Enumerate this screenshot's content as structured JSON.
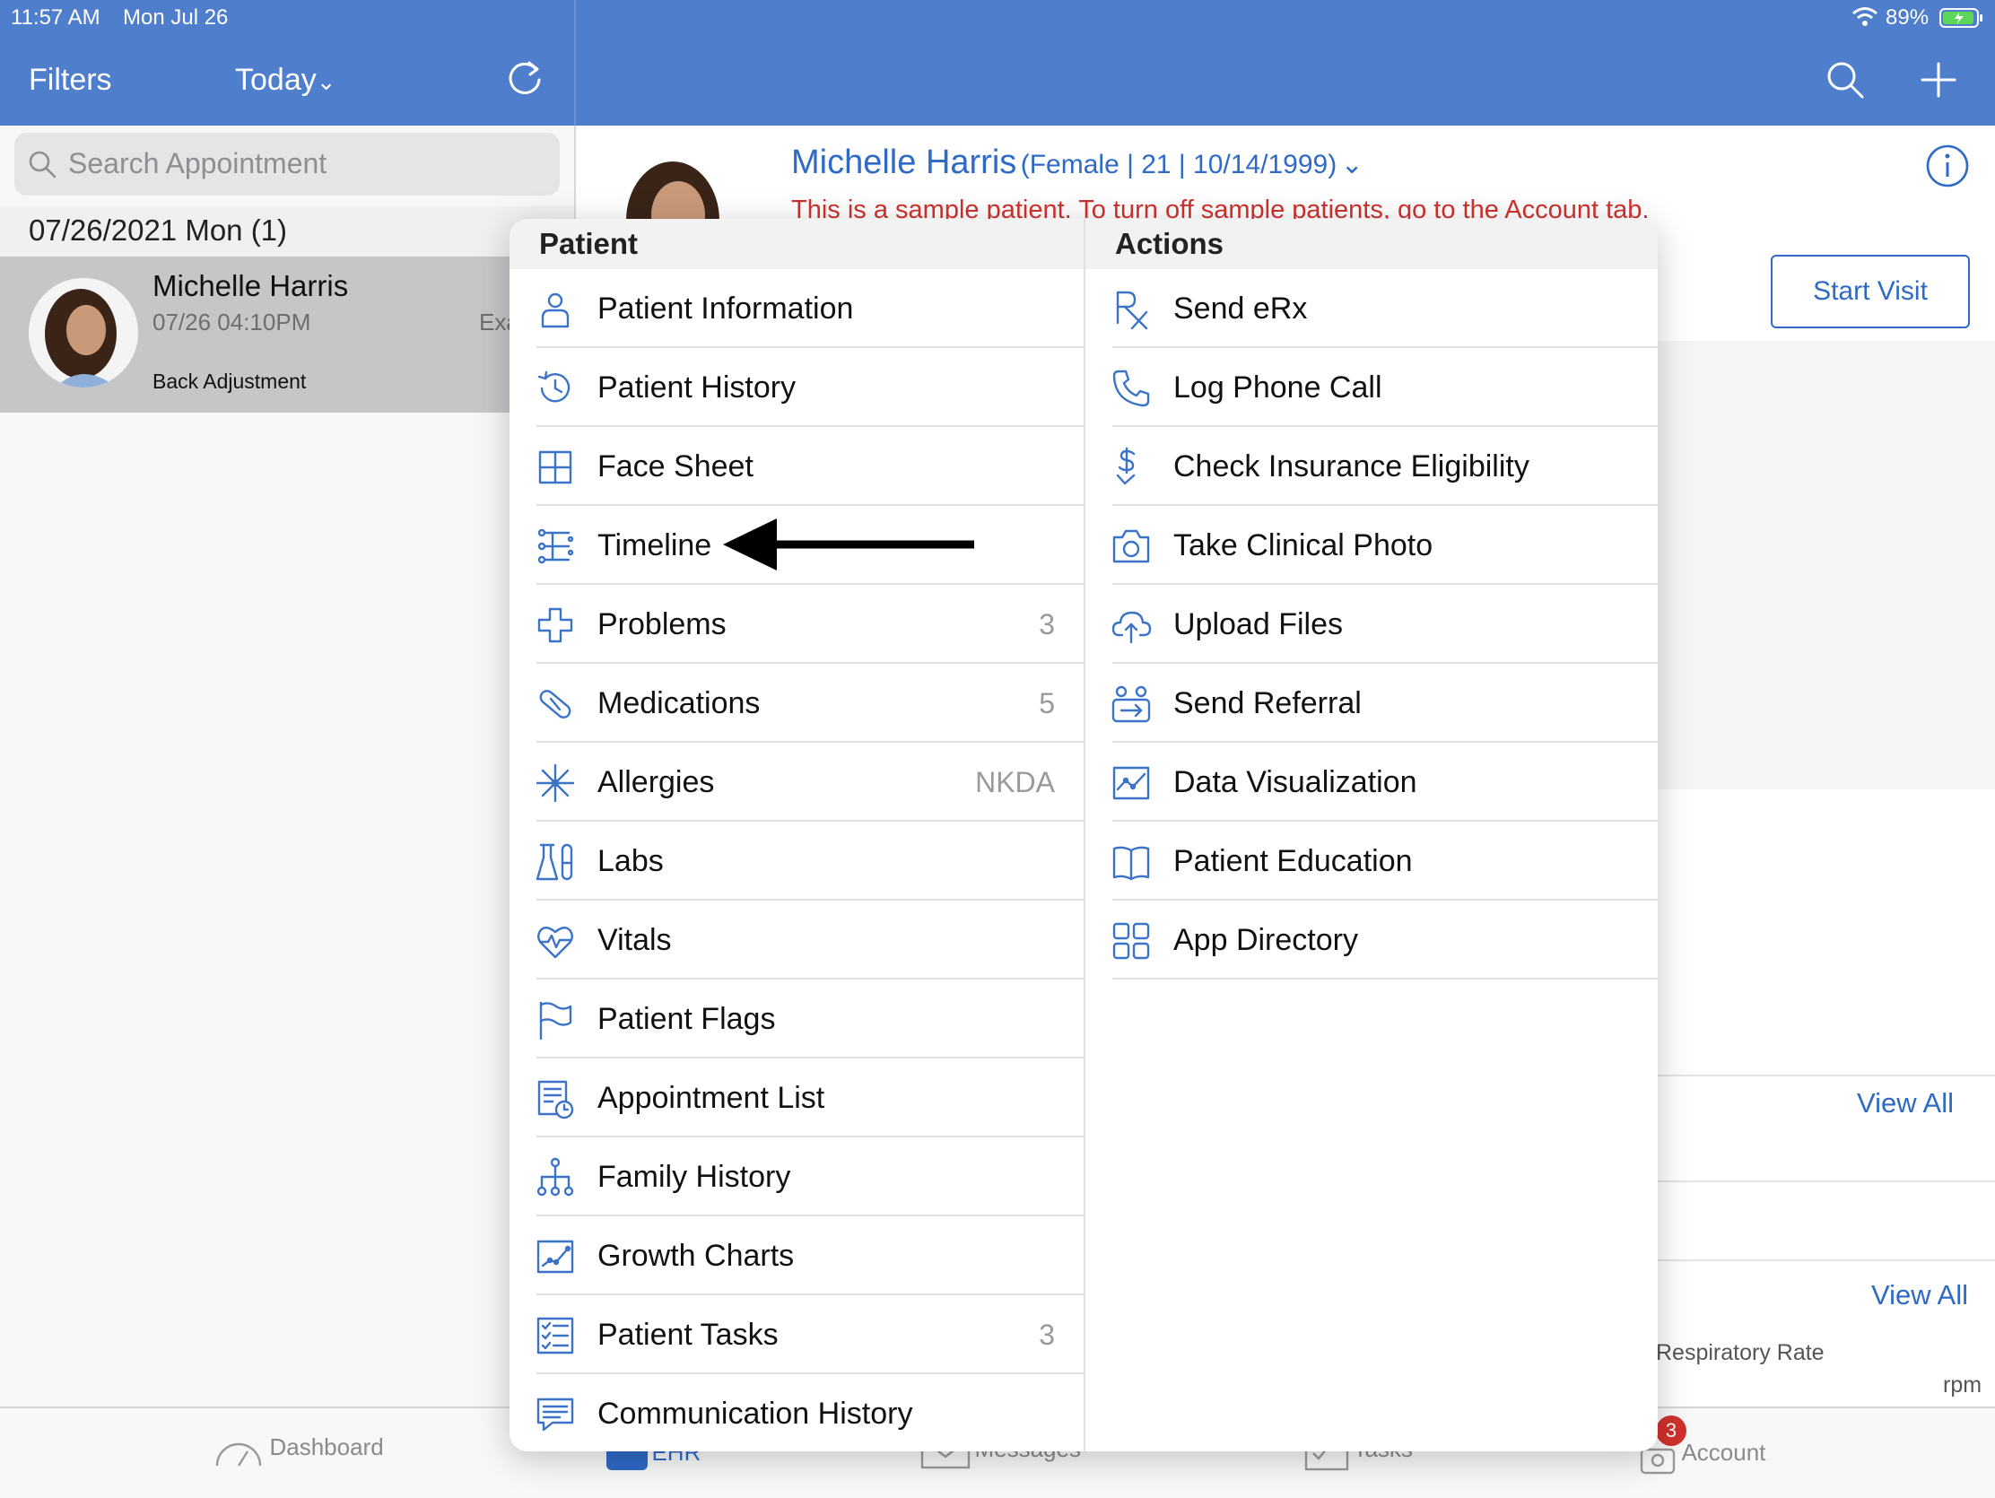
{
  "status": {
    "time": "11:57 AM",
    "date": "Mon Jul 26",
    "battery": "89%"
  },
  "nav": {
    "filters": "Filters",
    "today": "Today",
    "today_caret": "⌄"
  },
  "search": {
    "placeholder": "Search Appointment"
  },
  "schedule": {
    "date_header": "07/26/2021 Mon (1)",
    "appointment": {
      "name": "Michelle Harris",
      "time": "07/26 04:10PM",
      "reason": "Back Adjustment",
      "truncated_type": "Exa"
    }
  },
  "patient": {
    "name": "Michelle Harris",
    "details": "(Female | 21 | 10/14/1999)",
    "notice": "This is a sample patient. To turn off sample patients, go to the Account tab.",
    "start_visit": "Start Visit"
  },
  "background": {
    "view_all_1": "View All",
    "view_all_2": "View All",
    "respiratory": "Respiratory Rate",
    "rpm": "rpm"
  },
  "popover": {
    "patient_header": "Patient",
    "actions_header": "Actions",
    "patient_items": [
      {
        "label": "Patient Information",
        "icon": "person-icon",
        "count": ""
      },
      {
        "label": "Patient History",
        "icon": "history-clock-icon",
        "count": ""
      },
      {
        "label": "Face Sheet",
        "icon": "grid-icon",
        "count": ""
      },
      {
        "label": "Timeline",
        "icon": "timeline-icon",
        "count": ""
      },
      {
        "label": "Problems",
        "icon": "medical-cross-icon",
        "count": "3"
      },
      {
        "label": "Medications",
        "icon": "pill-icon",
        "count": "5"
      },
      {
        "label": "Allergies",
        "icon": "allergy-burst-icon",
        "count": "NKDA"
      },
      {
        "label": "Labs",
        "icon": "lab-flask-icon",
        "count": ""
      },
      {
        "label": "Vitals",
        "icon": "heart-pulse-icon",
        "count": ""
      },
      {
        "label": "Patient Flags",
        "icon": "flag-icon",
        "count": ""
      },
      {
        "label": "Appointment List",
        "icon": "appointment-list-icon",
        "count": ""
      },
      {
        "label": "Family History",
        "icon": "family-tree-icon",
        "count": ""
      },
      {
        "label": "Growth Charts",
        "icon": "growth-chart-icon",
        "count": ""
      },
      {
        "label": "Patient Tasks",
        "icon": "checklist-icon",
        "count": "3"
      },
      {
        "label": "Communication History",
        "icon": "chat-bubble-icon",
        "count": ""
      }
    ],
    "action_items": [
      {
        "label": "Send eRx",
        "icon": "rx-icon"
      },
      {
        "label": "Log Phone Call",
        "icon": "phone-icon"
      },
      {
        "label": "Check Insurance Eligibility",
        "icon": "dollar-check-icon"
      },
      {
        "label": "Take Clinical Photo",
        "icon": "camera-icon"
      },
      {
        "label": "Upload Files",
        "icon": "cloud-upload-icon"
      },
      {
        "label": "Send Referral",
        "icon": "referral-icon"
      },
      {
        "label": "Data Visualization",
        "icon": "data-chart-icon"
      },
      {
        "label": "Patient Education",
        "icon": "open-book-icon"
      },
      {
        "label": "App Directory",
        "icon": "app-grid-icon"
      }
    ]
  },
  "tabbar": {
    "dashboard": "Dashboard",
    "ehr": "EHR",
    "messages": "Messages",
    "tasks": "Tasks",
    "account": "Account",
    "account_badge": "3"
  },
  "colors": {
    "nav_blue": "#4f7ecd",
    "link_blue": "#2f6ac7",
    "notice_red": "#d0312d",
    "icon_blue": "#3b73c9"
  }
}
